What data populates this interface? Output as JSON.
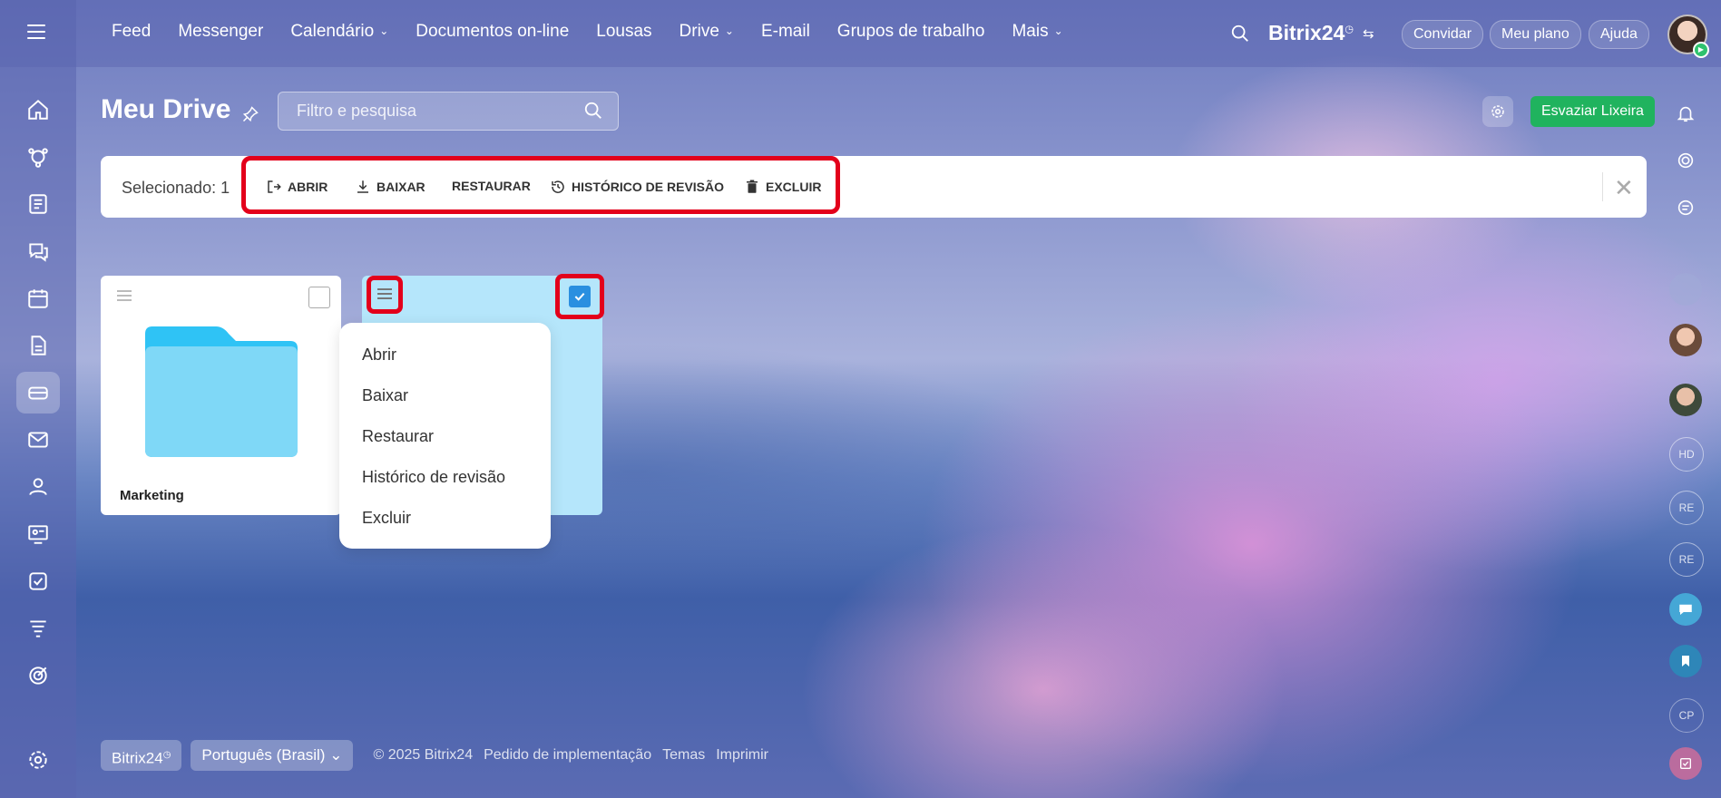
{
  "topnav": {
    "items": [
      {
        "label": "Feed",
        "dropdown": false
      },
      {
        "label": "Messenger",
        "dropdown": false
      },
      {
        "label": "Calendário",
        "dropdown": true
      },
      {
        "label": "Documentos on-line",
        "dropdown": false
      },
      {
        "label": "Lousas",
        "dropdown": false
      },
      {
        "label": "Drive",
        "dropdown": true
      },
      {
        "label": "E-mail",
        "dropdown": false
      },
      {
        "label": "Grupos de trabalho",
        "dropdown": false
      },
      {
        "label": "Mais",
        "dropdown": true
      }
    ],
    "brand": "Bitrix24",
    "invite": "Convidar",
    "plan": "Meu plano",
    "help": "Ajuda"
  },
  "page": {
    "title": "Meu Drive",
    "search_placeholder": "Filtro e pesquisa",
    "empty_trash": "Esvaziar Lixeira"
  },
  "action_panel": {
    "selected": "Selecionado: 1",
    "open": "ABRIR",
    "download": "BAIXAR",
    "restore": "RESTAURAR",
    "history": "HISTÓRICO DE REVISÃO",
    "delete": "EXCLUIR"
  },
  "items": [
    {
      "name": "Marketing",
      "type": "folder",
      "selected": false
    },
    {
      "name": "",
      "type": "file",
      "selected": true
    }
  ],
  "context_menu": {
    "items": [
      "Abrir",
      "Baixar",
      "Restaurar",
      "Histórico de revisão",
      "Excluir"
    ]
  },
  "footer": {
    "brand": "Bitrix24",
    "language": "Português (Brasil)",
    "copyright": "© 2025 Bitrix24",
    "link1": "Pedido de implementação",
    "link2": "Temas",
    "link3": "Imprimir"
  },
  "right_panel": {
    "initials": [
      "HD",
      "RE",
      "RE",
      "CP"
    ]
  },
  "colors": {
    "accent_green": "#20b35e",
    "highlight_red": "#e3001b",
    "checkbox_blue": "#2a8fe0",
    "folder_blue": "#7fd8f7",
    "selected_card": "#b5e6fb"
  }
}
